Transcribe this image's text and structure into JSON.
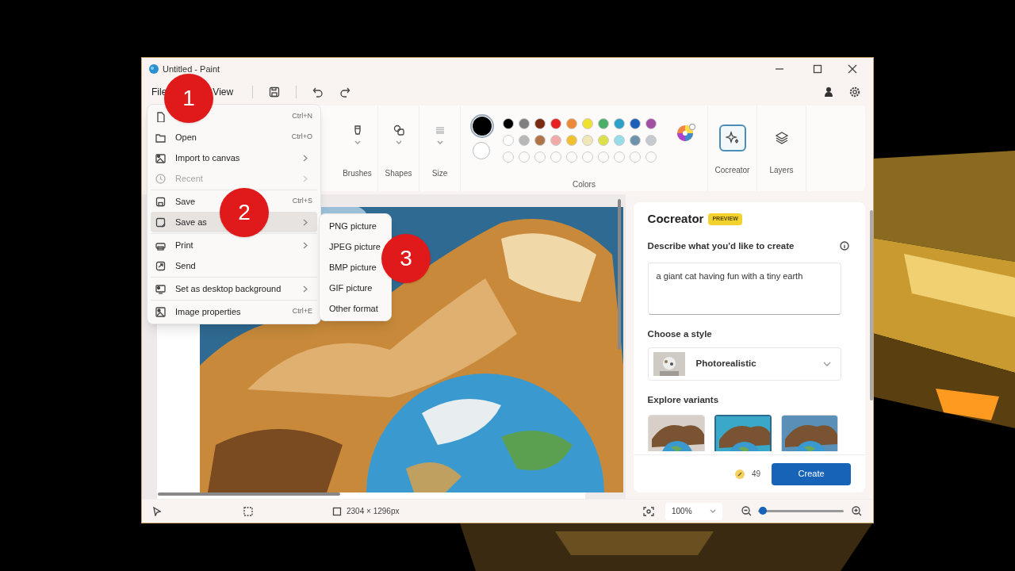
{
  "window": {
    "title": "Untitled - Paint"
  },
  "menu_bar": [
    {
      "label": "File"
    },
    {
      "label": "View"
    }
  ],
  "file_menu": [
    {
      "shortcut": "Ctrl+N",
      "submenu": false,
      "disabled": false,
      "selected": false
    },
    {
      "label": "Open",
      "shortcut": "Ctrl+O",
      "submenu": false,
      "disabled": false,
      "selected": false
    },
    {
      "label": "Import to canvas",
      "submenu": true,
      "disabled": false,
      "selected": false
    },
    {
      "label": "Recent",
      "submenu": true,
      "disabled": true,
      "selected": false
    },
    {
      "label": "Save",
      "shortcut": "Ctrl+S",
      "submenu": false,
      "disabled": false,
      "selected": false
    },
    {
      "label": "Save as",
      "submenu": true,
      "disabled": false,
      "selected": true
    },
    {
      "label": "Print",
      "submenu": true,
      "disabled": false,
      "selected": false
    },
    {
      "label": "Send",
      "submenu": false,
      "disabled": false,
      "selected": false
    },
    {
      "label": "Set as desktop background",
      "submenu": true,
      "disabled": false,
      "selected": false
    },
    {
      "label": "Image properties",
      "shortcut": "Ctrl+E",
      "submenu": false,
      "disabled": false,
      "selected": false
    }
  ],
  "save_as_submenu": [
    "PNG picture",
    "JPEG picture",
    "BMP picture",
    "GIF picture",
    "Other format"
  ],
  "step_markers": [
    "1",
    "2",
    "3"
  ],
  "ribbon": {
    "tools": [
      {
        "label": "Brushes"
      },
      {
        "label": "Shapes"
      },
      {
        "label": "Size"
      }
    ],
    "colors": {
      "label": "Colors",
      "current": [
        {
          "color": "#000000",
          "selected": true
        },
        {
          "color": "#ffffff",
          "selected": false
        }
      ],
      "swatches": [
        {
          "kind": "swatch",
          "color": "#000000"
        },
        {
          "kind": "swatch",
          "color": "#7f7f7f"
        },
        {
          "kind": "swatch",
          "color": "#7a2a10"
        },
        {
          "kind": "swatch",
          "color": "#e52020"
        },
        {
          "kind": "swatch",
          "color": "#ec8a3a"
        },
        {
          "kind": "swatch",
          "color": "#f0e030"
        },
        {
          "kind": "swatch",
          "color": "#4caf68"
        },
        {
          "kind": "swatch",
          "color": "#2ea0c8"
        },
        {
          "kind": "swatch",
          "color": "#1f5fb8"
        },
        {
          "kind": "swatch",
          "color": "#a050a0"
        },
        {
          "kind": "swatch",
          "color": "#ffffff"
        },
        {
          "kind": "swatch",
          "color": "#b8b8b8"
        },
        {
          "kind": "swatch",
          "color": "#b07448"
        },
        {
          "kind": "swatch",
          "color": "#f0aaaa"
        },
        {
          "kind": "swatch",
          "color": "#f0c030"
        },
        {
          "kind": "swatch",
          "color": "#f0e6b8"
        },
        {
          "kind": "swatch",
          "color": "#dce04a"
        },
        {
          "kind": "swatch",
          "color": "#98dcea"
        },
        {
          "kind": "swatch",
          "color": "#6e92aa"
        },
        {
          "kind": "swatch",
          "color": "#c4cad0"
        },
        {
          "kind": "empty"
        },
        {
          "kind": "empty"
        },
        {
          "kind": "empty"
        },
        {
          "kind": "empty"
        },
        {
          "kind": "empty"
        },
        {
          "kind": "empty"
        },
        {
          "kind": "empty"
        },
        {
          "kind": "empty"
        },
        {
          "kind": "empty"
        },
        {
          "kind": "empty"
        }
      ]
    },
    "cocreator": {
      "label": "Cocreator",
      "selected": true
    },
    "layers": {
      "label": "Layers",
      "selected": false
    }
  },
  "cocreator_panel": {
    "title": "Cocreator",
    "badge": "PREVIEW",
    "prompt_label": "Describe what you'd like to create",
    "prompt": "a giant cat having fun with a tiny earth",
    "style_label": "Choose a style",
    "style": "Photorealistic",
    "variants_label": "Explore variants",
    "variants": [
      {
        "selected": false
      },
      {
        "selected": true
      },
      {
        "selected": false
      }
    ],
    "credits": "49",
    "create_button": "Create"
  },
  "status_bar": {
    "dimensions": "2304 × 1296px",
    "zoom": "100%",
    "zoom_slider": {
      "level": 0.06
    }
  }
}
